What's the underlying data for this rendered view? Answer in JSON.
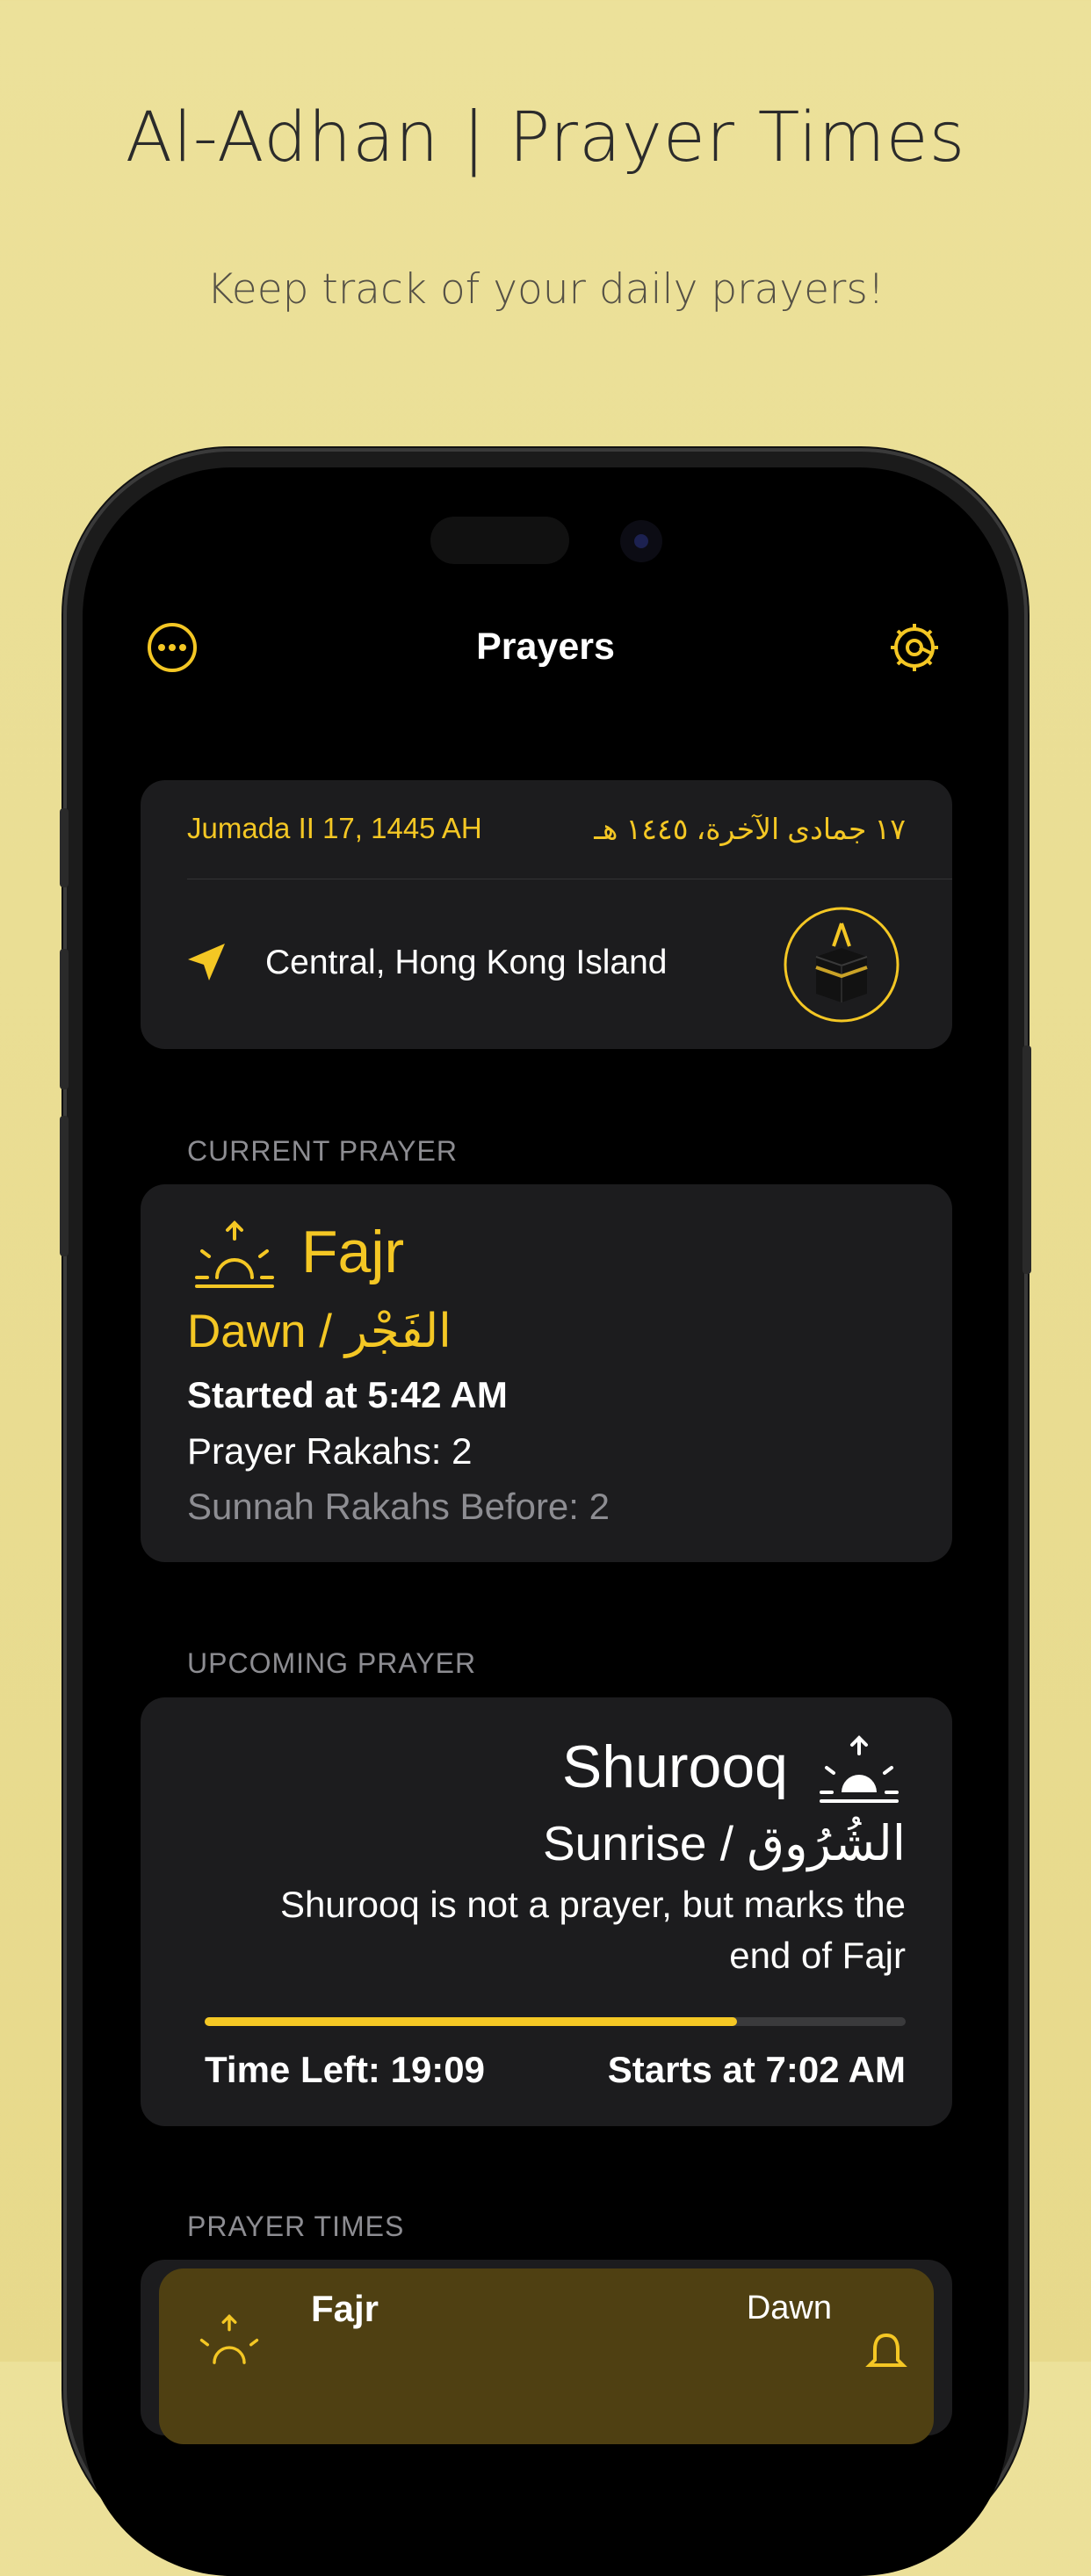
{
  "headline": "Al-Adhan | Prayer Times",
  "subline": "Keep track of your daily prayers!",
  "nav": {
    "title": "Prayers",
    "left_icon": "ellipsis-circle-icon",
    "right_icon": "gear-icon"
  },
  "date_card": {
    "hijri_en": "Jumada II 17, 1445 AH",
    "hijri_ar": "١٧ جمادى الآخرة، ١٤٤٥ هـ",
    "location": "Central, Hong Kong Island",
    "location_icon": "location-arrow-icon",
    "qibla_icon": "kaaba-compass-icon"
  },
  "current": {
    "section_label": "CURRENT PRAYER",
    "name": "Fajr",
    "subtitle": "Dawn / الفَجْر",
    "started": "Started at 5:42 AM",
    "rakahs": "Prayer Rakahs: 2",
    "sunnah": "Sunnah Rakahs Before: 2"
  },
  "upcoming": {
    "section_label": "UPCOMING PRAYER",
    "name": "Shurooq",
    "subtitle": "Sunrise / الشُرُوق",
    "note_line1": "Shurooq is not a prayer, but marks the",
    "note_line2": "end of Fajr",
    "progress": 0.76,
    "time_left": "Time Left: 19:09",
    "starts": "Starts at 7:02 AM"
  },
  "prayer_times": {
    "section_label": "PRAYER TIMES",
    "rows": [
      {
        "name": "Fajr",
        "meaning": "Dawn"
      }
    ]
  },
  "colors": {
    "accent": "#f4c724",
    "card": "#1c1c1e",
    "background_top": "#ece19a",
    "highlight_row": "#4f4012"
  }
}
